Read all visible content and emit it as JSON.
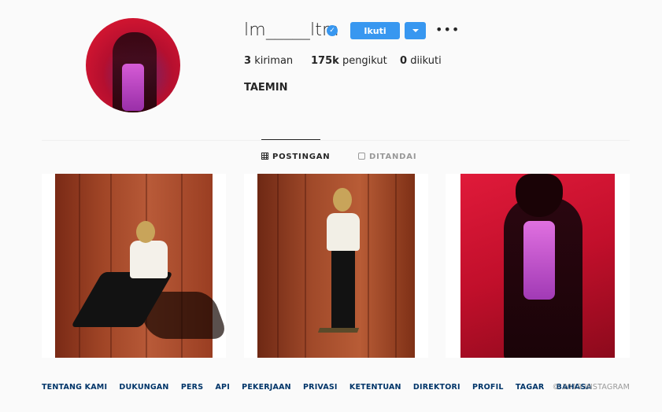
{
  "profile": {
    "username": "lm_____ltm",
    "verified_icon": "verified-badge-icon",
    "follow_label": "Ikuti",
    "posts_count": "3",
    "posts_label": "kiriman",
    "followers_count": "175k",
    "followers_label": "pengikut",
    "following_count": "0",
    "following_label": "diikuti",
    "full_name": "TAEMIN"
  },
  "tabs": [
    {
      "label": "POSTINGAN",
      "icon": "grid-icon",
      "active": true
    },
    {
      "label": "DITANDAI",
      "icon": "tagged-icon",
      "active": false
    }
  ],
  "footer": {
    "links": [
      "TENTANG KAMI",
      "DUKUNGAN",
      "PERS",
      "API",
      "PEKERJAAN",
      "PRIVASI",
      "KETENTUAN",
      "DIREKTORI",
      "PROFIL",
      "TAGAR",
      "BAHASA"
    ],
    "copyright": "© 2019 INSTAGRAM"
  },
  "colors": {
    "accent": "#3897f0",
    "link": "#003569"
  }
}
